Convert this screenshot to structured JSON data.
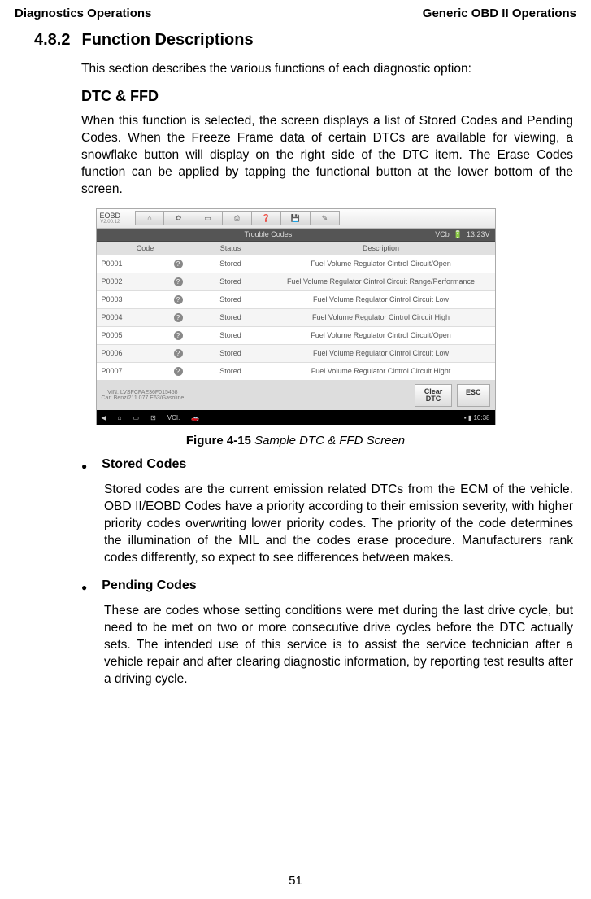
{
  "header": {
    "left": "Diagnostics Operations",
    "right": "Generic OBD II Operations"
  },
  "section": {
    "number": "4.8.2",
    "title": "Function Descriptions"
  },
  "intro": "This section describes the various functions of each diagnostic option:",
  "sub1_title": "DTC & FFD",
  "sub1_body": "When this function is selected, the screen displays a list of Stored Codes and Pending Codes. When the Freeze Frame data of certain DTCs are available for viewing, a snowflake button will display on the right side of the DTC item. The Erase Codes function can be applied by tapping the functional button at the lower bottom of the screen.",
  "figure": {
    "label": "Figure 4-15",
    "title": " Sample DTC & FFD Screen"
  },
  "bullets": {
    "b1": {
      "label": "Stored Codes",
      "body": "Stored codes are the current emission related DTCs from the ECM of the vehicle. OBD II/EOBD Codes have a priority according to their emission severity, with higher priority codes overwriting lower priority codes. The priority of the code determines the illumination of the MIL and the codes erase procedure. Manufacturers rank codes differently, so expect to see differences between makes."
    },
    "b2": {
      "label": "Pending Codes",
      "body": "These are codes whose setting conditions were met during the last drive cycle, but need to be met on two or more consecutive drive cycles before the DTC actually sets. The intended use of this service is to assist the service technician after a vehicle repair and after clearing diagnostic information, by reporting test results after a driving cycle."
    }
  },
  "page_number": "51",
  "device": {
    "brand": "EOBD",
    "version": "V2.00.12",
    "subbar_title": "Trouble Codes",
    "subbar_right_a": "VCb",
    "subbar_right_b": "13.23V",
    "col1": "Code",
    "col2": "Status",
    "col3": "Description",
    "rows": [
      {
        "code": "P0001",
        "status": "Stored",
        "desc": "Fuel Volume Regulator Cintrol Circuit/Open"
      },
      {
        "code": "P0002",
        "status": "Stored",
        "desc": "Fuel Volume Regulator Cintrol Circuit Range/Performance"
      },
      {
        "code": "P0003",
        "status": "Stored",
        "desc": "Fuel Volume Regulator Cintrol Circuit Low"
      },
      {
        "code": "P0004",
        "status": "Stored",
        "desc": "Fuel Volume Regulator Cintrol Circuit High"
      },
      {
        "code": "P0005",
        "status": "Stored",
        "desc": "Fuel Volume Regulator Cintrol Circuit/Open"
      },
      {
        "code": "P0006",
        "status": "Stored",
        "desc": "Fuel Volume Regulator Cintrol Circuit Low"
      },
      {
        "code": "P0007",
        "status": "Stored",
        "desc": "Fuel Volume Regulator Cintrol Circuit Hight"
      }
    ],
    "vin_line": "VIN: LVSFCFAE36F015458",
    "car_line": "Car: Benz/211.077 E63/Gasoline",
    "btn_clear": "Clear DTC",
    "btn_esc": "ESC",
    "time": "10:38"
  }
}
